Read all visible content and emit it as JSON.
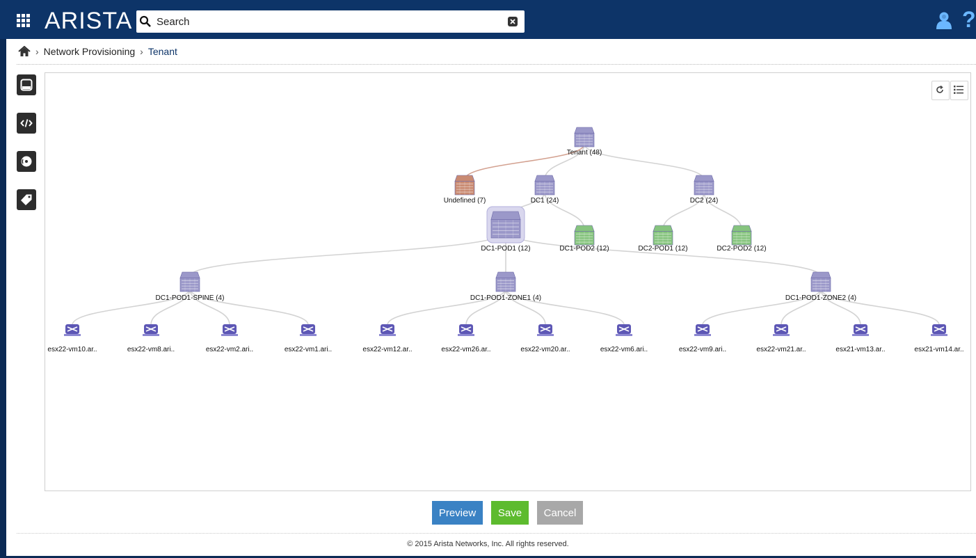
{
  "header": {
    "logo": "ARISTA",
    "search_placeholder": "Search",
    "help_glyph": "?",
    "colors": {
      "topbar": "#0d3468",
      "help": "#6bb7ff"
    }
  },
  "breadcrumb": {
    "home_icon": "home-icon",
    "items": [
      "Network Provisioning",
      "Tenant"
    ]
  },
  "sidebar": {
    "buttons": [
      {
        "name": "device-icon"
      },
      {
        "name": "code-icon"
      },
      {
        "name": "disc-icon"
      },
      {
        "name": "tag-icon"
      }
    ]
  },
  "topology_tools": {
    "refresh_icon": "refresh-icon",
    "list_icon": "list-icon"
  },
  "topology": {
    "colors": {
      "container": "#9b98c9",
      "undefined": "#c98a72",
      "leaf": "#86c47e",
      "vm": "#5d57b5",
      "link": "#d3d3d3",
      "link_undefined": "#d3a190"
    },
    "nodes": [
      {
        "id": "tenant",
        "label": "Tenant (48)",
        "kind": "container"
      },
      {
        "id": "undefined",
        "label": "Undefined (7)",
        "kind": "undefined"
      },
      {
        "id": "dc1",
        "label": "DC1 (24)",
        "kind": "container"
      },
      {
        "id": "dc2",
        "label": "DC2 (24)",
        "kind": "container"
      },
      {
        "id": "dc1pod1",
        "label": "DC1-POD1 (12)",
        "kind": "container-selected"
      },
      {
        "id": "dc1pod2",
        "label": "DC1-POD2 (12)",
        "kind": "leaf"
      },
      {
        "id": "dc2pod1",
        "label": "DC2-POD1 (12)",
        "kind": "leaf"
      },
      {
        "id": "dc2pod2",
        "label": "DC2-POD2 (12)",
        "kind": "leaf"
      },
      {
        "id": "spine",
        "label": "DC1-POD1-SPINE (4)",
        "kind": "container"
      },
      {
        "id": "zone1",
        "label": "DC1-POD1-ZONE1 (4)",
        "kind": "container"
      },
      {
        "id": "zone2",
        "label": "DC1-POD1-ZONE2 (4)",
        "kind": "container"
      },
      {
        "id": "vm1",
        "label": "esx22-vm10.ar..",
        "kind": "vm",
        "parent": "spine"
      },
      {
        "id": "vm2",
        "label": "esx22-vm8.ari..",
        "kind": "vm",
        "parent": "spine"
      },
      {
        "id": "vm3",
        "label": "esx22-vm2.ari..",
        "kind": "vm",
        "parent": "spine"
      },
      {
        "id": "vm4",
        "label": "esx22-vm1.ari..",
        "kind": "vm",
        "parent": "spine"
      },
      {
        "id": "vm5",
        "label": "esx22-vm12.ar..",
        "kind": "vm",
        "parent": "zone1"
      },
      {
        "id": "vm6",
        "label": "esx22-vm26.ar..",
        "kind": "vm",
        "parent": "zone1"
      },
      {
        "id": "vm7",
        "label": "esx22-vm20.ar..",
        "kind": "vm",
        "parent": "zone1"
      },
      {
        "id": "vm8",
        "label": "esx22-vm6.ari..",
        "kind": "vm",
        "parent": "zone1"
      },
      {
        "id": "vm9",
        "label": "esx22-vm9.ari..",
        "kind": "vm",
        "parent": "zone2"
      },
      {
        "id": "vm10",
        "label": "esx22-vm21.ar..",
        "kind": "vm",
        "parent": "zone2"
      },
      {
        "id": "vm11",
        "label": "esx21-vm13.ar..",
        "kind": "vm",
        "parent": "zone2"
      },
      {
        "id": "vm12",
        "label": "esx21-vm14.ar..",
        "kind": "vm",
        "parent": "zone2"
      }
    ]
  },
  "actions": {
    "preview": "Preview",
    "save": "Save",
    "cancel": "Cancel"
  },
  "footer": {
    "text": "© 2015 Arista Networks, Inc. All rights reserved."
  }
}
